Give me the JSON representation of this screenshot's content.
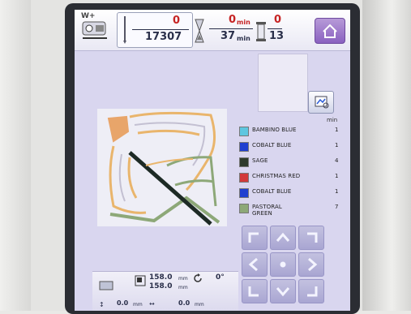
{
  "header": {
    "wt_label": "W+",
    "stitch_current": "0",
    "stitch_total": "17307",
    "time_current": "0",
    "time_current_unit": "min",
    "time_total": "37",
    "time_total_unit": "min",
    "color_current": "0",
    "color_total": "13"
  },
  "threads": {
    "min_header": "min",
    "items": [
      {
        "name": "BAMBINO BLUE",
        "minutes": "1",
        "color": "#5ec6e0"
      },
      {
        "name": "COBALT BLUE",
        "minutes": "1",
        "color": "#1f3fd0"
      },
      {
        "name": "SAGE",
        "minutes": "4",
        "color": "#2e3b2c"
      },
      {
        "name": "CHRISTMAS RED",
        "minutes": "1",
        "color": "#d23a3a"
      },
      {
        "name": "COBALT BLUE",
        "minutes": "1",
        "color": "#1f3fd0"
      },
      {
        "name": "PASTORAL GREEN",
        "minutes": "7",
        "color": "#8da878"
      }
    ]
  },
  "footer": {
    "width": "158.0",
    "height": "158.0",
    "unit": "mm",
    "rotation": "0°",
    "offset_x": "0.0",
    "offset_y": "0.0"
  },
  "icons": {
    "home": "home-icon",
    "wt": "thread-width-icon",
    "needle": "needle-icon",
    "hourglass": "hourglass-icon",
    "spool": "spool-icon",
    "preview": "preview-icon",
    "rotate": "rotate-icon"
  },
  "colors": {
    "screen_bg": "#d9d6ef",
    "accent_red": "#c62323",
    "home_purple": "#8a61c0"
  }
}
